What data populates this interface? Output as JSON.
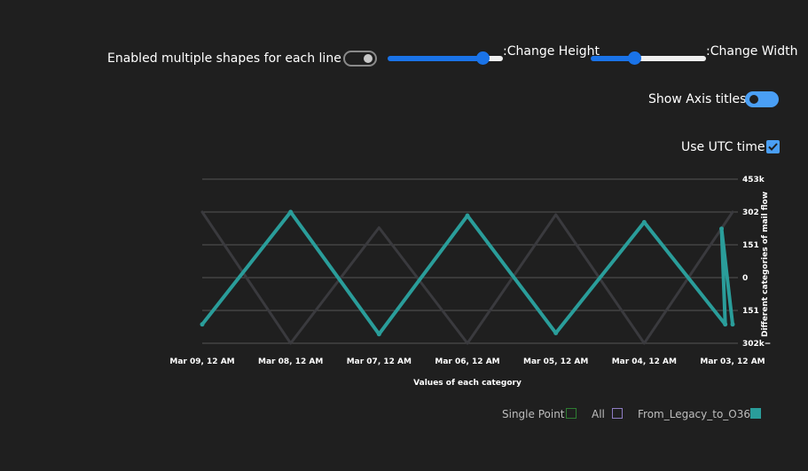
{
  "controls": {
    "multi_shapes_label": "Enabled multiple shapes for each line Off",
    "change_height_label": ":Change Height",
    "change_width_label": ":Change Width",
    "show_axis_titles_label": "Show Axis titles",
    "use_utc_label": "Use UTC time",
    "multi_shapes_on": false,
    "show_axis_titles_on": true,
    "use_utc_checked": true,
    "height_slider_fraction": 0.82,
    "width_slider_fraction": 0.38
  },
  "colors": {
    "background": "#1f1f1f",
    "series_main": "#2a9d9a",
    "series_faint": "#3a3a3e",
    "gridline": "#555555",
    "accent": "#4a9ff5",
    "single_point_swatch": "#2e7d32",
    "all_swatch": "#8e7cc3"
  },
  "chart_data": {
    "type": "line",
    "xlabel": "Values of each category",
    "ylabel": "Different categories of mail flow",
    "x_tick_labels": [
      "Mar 09, 12 AM",
      "Mar 08, 12 AM",
      "Mar 07, 12 AM",
      "Mar 06, 12 AM",
      "Mar 05, 12 AM",
      "Mar 04, 12 AM",
      "Mar 03, 12 AM"
    ],
    "y_tick_labels": [
      "453k",
      "302",
      "151",
      "0",
      "151",
      "302k−"
    ],
    "y_tick_values": [
      453000,
      302000,
      151000,
      0,
      -151000,
      -302000
    ],
    "ylim": [
      -302000,
      453000
    ],
    "x_reversed": true,
    "y_axis_position": "right",
    "grid": true,
    "legend_position": "bottom-right",
    "series": [
      {
        "name": "From_Legacy_to_O365",
        "points": [
          {
            "x": "Mar 09, 12 AM",
            "y": -215000
          },
          {
            "x": "Mar 08, 12 AM",
            "y": 302000
          },
          {
            "x": "Mar 07, 12 AM",
            "y": -260000
          },
          {
            "x": "Mar 06, 12 AM",
            "y": 285000
          },
          {
            "x": "Mar 05, 12 AM",
            "y": -255000
          },
          {
            "x": "Mar 04, 12 AM",
            "y": 255000
          },
          {
            "x": "Mar 03, 14 AM",
            "y": -215000
          },
          {
            "x": "Mar 03, 15 AM",
            "y": 225000
          },
          {
            "x": "Mar 03, 12 AM",
            "y": -215000
          }
        ]
      },
      {
        "name": "All",
        "points": [
          {
            "x": "Mar 09, 12 AM",
            "y": 302000
          },
          {
            "x": "Mar 08, 12 AM",
            "y": -302000
          },
          {
            "x": "Mar 07, 12 AM",
            "y": 230000
          },
          {
            "x": "Mar 06, 12 AM",
            "y": -302000
          },
          {
            "x": "Mar 05, 12 AM",
            "y": 290000
          },
          {
            "x": "Mar 04, 12 AM",
            "y": -302000
          },
          {
            "x": "Mar 03, 12 AM",
            "y": 302000
          }
        ]
      }
    ]
  },
  "legend": {
    "items": [
      {
        "label": "Single Point"
      },
      {
        "label": "All"
      },
      {
        "label": "From_Legacy_to_O365"
      }
    ]
  }
}
